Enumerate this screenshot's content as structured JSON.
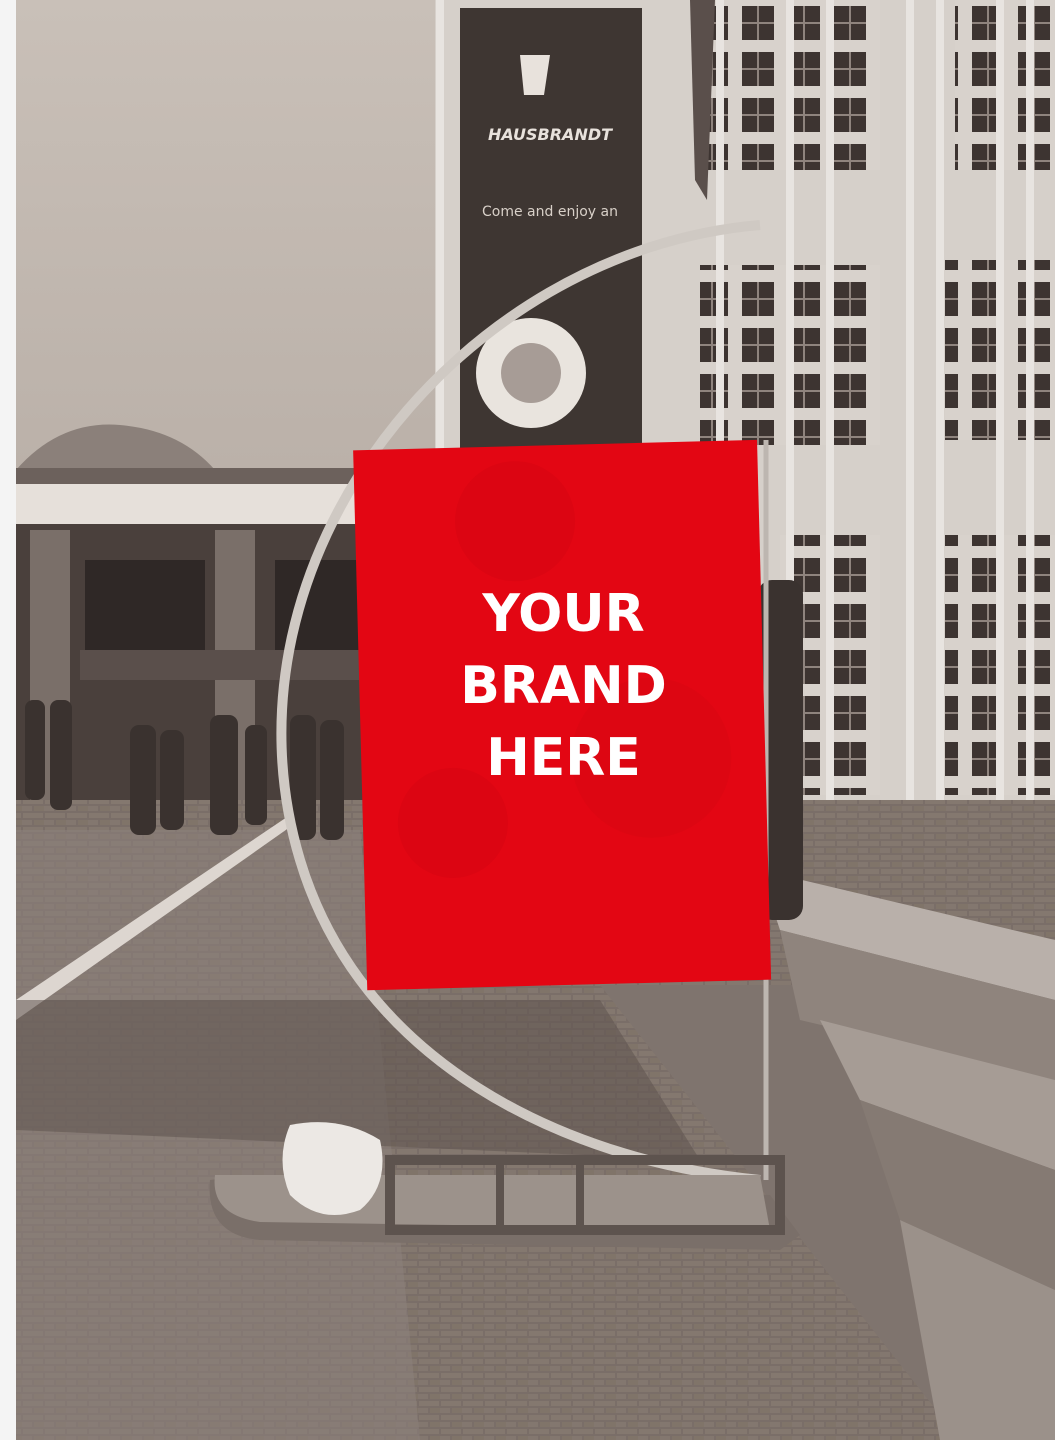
{
  "photo": {
    "tone": "sepia",
    "accent_color": "#e30613",
    "sign": {
      "line1": "YOUR",
      "line2": "BRAND",
      "line3": "HERE"
    },
    "background_banner": {
      "brand": "HAUSBRANDT",
      "tagline": "Come and enjoy an"
    }
  }
}
